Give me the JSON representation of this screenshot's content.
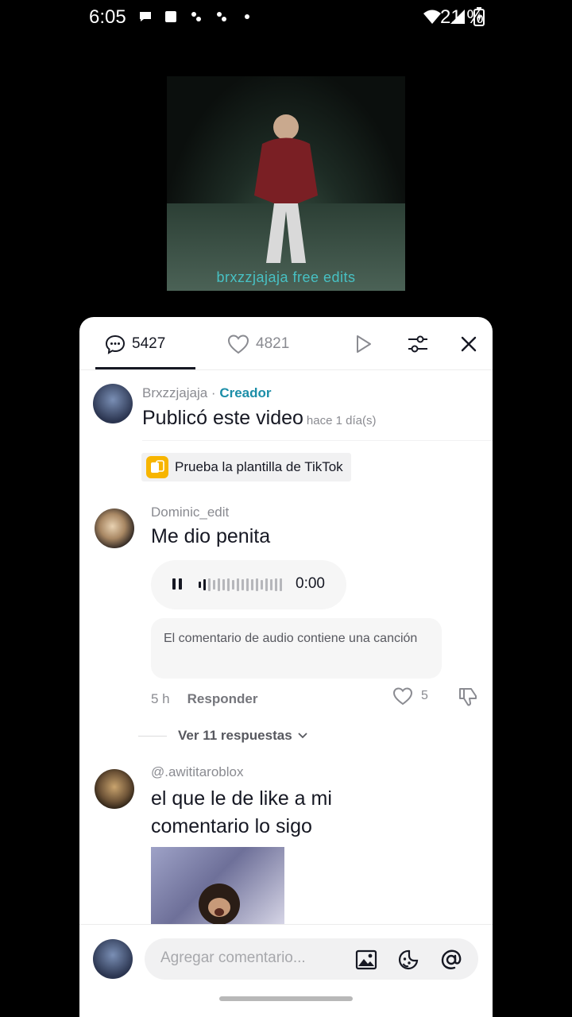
{
  "status_bar": {
    "time": "6:05",
    "battery_text": "21 %"
  },
  "video": {
    "caption": "brxzzjajaja free edits"
  },
  "tabs": {
    "comments_count": "5427",
    "likes_count": "4821"
  },
  "creator_post": {
    "username": "Brxzzjajaja",
    "separator": " · ",
    "badge": "Creador",
    "text": "Publicó este video",
    "time": "hace 1 día(s)"
  },
  "template_chip": {
    "label": "Prueba la plantilla de TikTok"
  },
  "comments": [
    {
      "username": "Dominic_edit",
      "text": "Me dio penita",
      "audio_time": "0:00",
      "audio_note": "El comentario de audio contiene una canción",
      "time": "5 h",
      "reply_label": "Responder",
      "likes": "5",
      "view_replies": "Ver 11 respuestas"
    },
    {
      "username": "@.awititaroblox",
      "text": "el que le de like a mi comentario lo sigo"
    }
  ],
  "composer": {
    "placeholder": "Agregar comentario..."
  },
  "colors": {
    "creator_badge": "#1c8ea8",
    "template_icon": "#f7b500",
    "text_primary": "#161823",
    "text_secondary": "#8a8b91"
  }
}
